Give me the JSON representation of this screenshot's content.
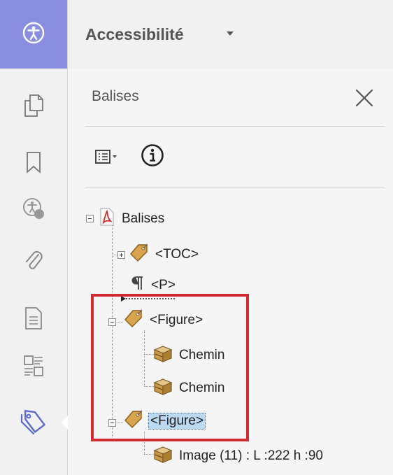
{
  "app": {
    "title": "Accessibilité"
  },
  "panel": {
    "title": "Balises"
  },
  "rail": {
    "icons": [
      "accessibility-icon",
      "pages-icon",
      "bookmark-icon",
      "accessibility-check-icon",
      "attachment-icon",
      "document-icon",
      "content-icon",
      "tags-icon"
    ]
  },
  "tree": {
    "root": "Balises",
    "toc": "<TOC>",
    "p": "<P>",
    "figure1": "<Figure>",
    "path1": "Chemin",
    "path2": "Chemin",
    "figure2": "<Figure>",
    "image": "Image (11) : L :222 h :90"
  },
  "colors": {
    "accent": "#8a8ee0",
    "highlight": "#d22b33",
    "selection": "#bcd9f2"
  }
}
